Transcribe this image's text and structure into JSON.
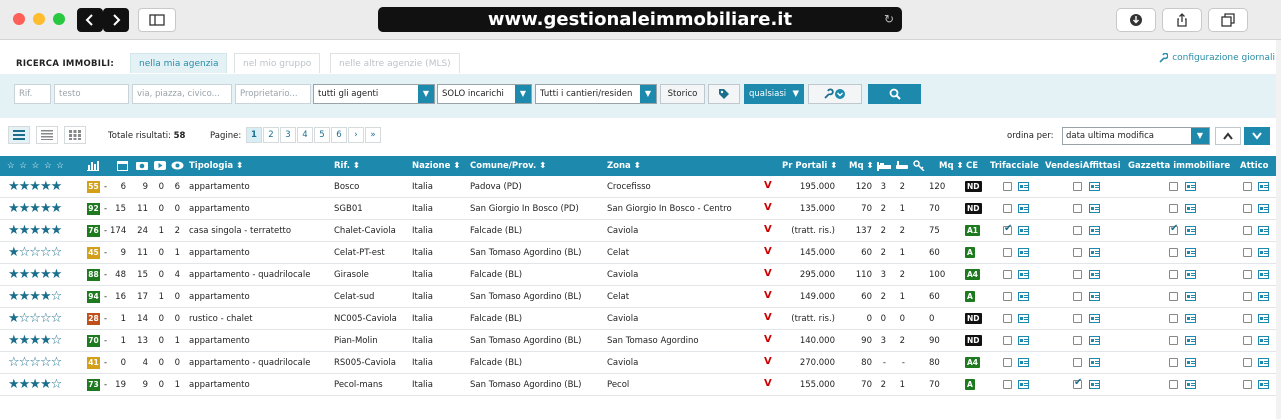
{
  "browser": {
    "url": "www.gestionaleimmobiliare.it"
  },
  "header": {
    "label": "RICERCA IMMOBILI:",
    "tabs": [
      "nella mia agenzia",
      "nel mio gruppo",
      "nelle altre agenzie (MLS)"
    ],
    "config_link": "configurazione giornali"
  },
  "filters": {
    "rif_placeholder": "Rif.",
    "testo_placeholder": "testo",
    "address_placeholder": "via, piazza, civico...",
    "owner_placeholder": "Proprietario...",
    "agent_select": "tutti gli agenti",
    "type_select": "SOLO incarichi",
    "site_select": "Tutti i cantieri/residen",
    "storico_label": "Storico",
    "any_select": "qualsiasi"
  },
  "toolbar": {
    "total_label": "Totale risultati:",
    "total_value": "58",
    "pages_label": "Pagine:",
    "pages": [
      "1",
      "2",
      "3",
      "4",
      "5",
      "6"
    ],
    "next": "›",
    "last": "»",
    "order_label": "ordina per:",
    "order_value": "data ultima modifica"
  },
  "table": {
    "headers": {
      "stars": "☆ ☆ ☆ ☆ ☆",
      "tipologia": "Tipologia ⬍",
      "rif": "Rif. ⬍",
      "nazione": "Nazione ⬍",
      "comune": "Comune/Prov. ⬍",
      "zona": "Zona ⬍",
      "pr_portali": "Pr Portali ⬍",
      "mq": "Mq ⬍",
      "mq2": "Mq ⬍",
      "ce": "CE",
      "trifacciale": "Trifacciale",
      "vendesi": "VendesiAffittasi",
      "gazzetta": "Gazzetta immobiliare",
      "attico": "Attico"
    },
    "rows": [
      {
        "stars": 5,
        "score": "55",
        "score_color": "#d4a017",
        "dash": "-",
        "c1": "6",
        "c2": "9",
        "c3": "0",
        "c4": "6",
        "tipologia": "appartamento",
        "rif": "Bosco",
        "nazione": "Italia",
        "comune": "Padova (PD)",
        "zona": "Crocefisso",
        "v": "V",
        "prezzo": "195.000",
        "mq": "120",
        "b1": "3",
        "b2": "2",
        "mq2": "120",
        "ce": "ND",
        "ce_color": "#111",
        "tri": false,
        "ven": false,
        "gaz": false,
        "att": false
      },
      {
        "stars": 5,
        "score": "92",
        "score_color": "#1e7a1e",
        "dash": "-",
        "c1": "15",
        "c2": "11",
        "c3": "0",
        "c4": "0",
        "tipologia": "appartamento",
        "rif": "SGB01",
        "nazione": "Italia",
        "comune": "San Giorgio In Bosco (PD)",
        "zona": "San Giorgio In Bosco - Centro",
        "v": "V",
        "prezzo": "135.000",
        "mq": "70",
        "b1": "2",
        "b2": "1",
        "mq2": "70",
        "ce": "ND",
        "ce_color": "#111",
        "tri": false,
        "ven": false,
        "gaz": false,
        "att": false
      },
      {
        "stars": 5,
        "score": "76",
        "score_color": "#1e7a1e",
        "dash": "-",
        "c1": "174",
        "c2": "24",
        "c3": "1",
        "c4": "2",
        "tipologia": "casa singola - terratetto",
        "rif": "Chalet-Caviola",
        "nazione": "Italia",
        "comune": "Falcade (BL)",
        "zona": "Caviola",
        "v": "V",
        "prezzo": "(tratt. ris.)",
        "mq": "137",
        "b1": "2",
        "b2": "2",
        "mq2": "75",
        "ce": "A1",
        "ce_color": "#1e7a1e",
        "tri": true,
        "ven": false,
        "gaz": true,
        "att": false
      },
      {
        "stars": 1,
        "score": "45",
        "score_color": "#d4a017",
        "dash": "-",
        "c1": "9",
        "c2": "11",
        "c3": "0",
        "c4": "1",
        "tipologia": "appartamento",
        "rif": "Celat-PT-est",
        "nazione": "Italia",
        "comune": "San Tomaso Agordino (BL)",
        "zona": "Celat",
        "v": "V",
        "prezzo": "145.000",
        "mq": "60",
        "b1": "2",
        "b2": "1",
        "mq2": "60",
        "ce": "A",
        "ce_color": "#1e7a1e",
        "tri": false,
        "ven": false,
        "gaz": false,
        "att": false
      },
      {
        "stars": 5,
        "score": "88",
        "score_color": "#1e7a1e",
        "dash": "-",
        "c1": "48",
        "c2": "15",
        "c3": "0",
        "c4": "4",
        "tipologia": "appartamento - quadrilocale",
        "rif": "Girasole",
        "nazione": "Italia",
        "comune": "Falcade (BL)",
        "zona": "Caviola",
        "v": "V",
        "prezzo": "295.000",
        "mq": "110",
        "b1": "3",
        "b2": "2",
        "mq2": "100",
        "ce": "A4",
        "ce_color": "#1e7a1e",
        "tri": false,
        "ven": false,
        "gaz": false,
        "att": false
      },
      {
        "stars": 4,
        "score": "94",
        "score_color": "#1e7a1e",
        "dash": "-",
        "c1": "16",
        "c2": "17",
        "c3": "1",
        "c4": "0",
        "tipologia": "appartamento",
        "rif": "Celat-sud",
        "nazione": "Italia",
        "comune": "San Tomaso Agordino (BL)",
        "zona": "Celat",
        "v": "V",
        "prezzo": "149.000",
        "mq": "60",
        "b1": "2",
        "b2": "1",
        "mq2": "60",
        "ce": "A",
        "ce_color": "#1e7a1e",
        "tri": false,
        "ven": false,
        "gaz": false,
        "att": false
      },
      {
        "stars": 1,
        "score": "28",
        "score_color": "#c0501a",
        "dash": "-",
        "c1": "1",
        "c2": "14",
        "c3": "0",
        "c4": "0",
        "tipologia": "rustico - chalet",
        "rif": "NC005-Caviola",
        "nazione": "Italia",
        "comune": "Falcade (BL)",
        "zona": "Caviola",
        "v": "V",
        "prezzo": "(tratt. ris.)",
        "mq": "0",
        "b1": "0",
        "b2": "0",
        "mq2": "0",
        "ce": "ND",
        "ce_color": "#111",
        "tri": false,
        "ven": false,
        "gaz": false,
        "att": false
      },
      {
        "stars": 4,
        "score": "70",
        "score_color": "#1e7a1e",
        "dash": "-",
        "c1": "1",
        "c2": "13",
        "c3": "0",
        "c4": "1",
        "tipologia": "appartamento",
        "rif": "Pian-Molin",
        "nazione": "Italia",
        "comune": "San Tomaso Agordino (BL)",
        "zona": "San Tomaso Agordino",
        "v": "V",
        "prezzo": "140.000",
        "mq": "90",
        "b1": "3",
        "b2": "2",
        "mq2": "90",
        "ce": "ND",
        "ce_color": "#111",
        "tri": false,
        "ven": false,
        "gaz": false,
        "att": false
      },
      {
        "stars": 0,
        "score": "41",
        "score_color": "#d4a017",
        "dash": "-",
        "c1": "0",
        "c2": "4",
        "c3": "0",
        "c4": "0",
        "tipologia": "appartamento - quadrilocale",
        "rif": "RS005-Caviola",
        "nazione": "Italia",
        "comune": "Falcade (BL)",
        "zona": "Caviola",
        "v": "V",
        "prezzo": "270.000",
        "mq": "80",
        "b1": "-",
        "b2": "-",
        "mq2": "80",
        "ce": "A4",
        "ce_color": "#1e7a1e",
        "tri": false,
        "ven": false,
        "gaz": false,
        "att": false
      },
      {
        "stars": 4,
        "score": "73",
        "score_color": "#1e7a1e",
        "dash": "-",
        "c1": "19",
        "c2": "9",
        "c3": "0",
        "c4": "1",
        "tipologia": "appartamento",
        "rif": "Pecol-mans",
        "nazione": "Italia",
        "comune": "San Tomaso Agordino (BL)",
        "zona": "Pecol",
        "v": "V",
        "prezzo": "155.000",
        "mq": "70",
        "b1": "2",
        "b2": "1",
        "mq2": "70",
        "ce": "A",
        "ce_color": "#1e7a1e",
        "tri": false,
        "ven": true,
        "gaz": false,
        "att": false
      }
    ]
  }
}
